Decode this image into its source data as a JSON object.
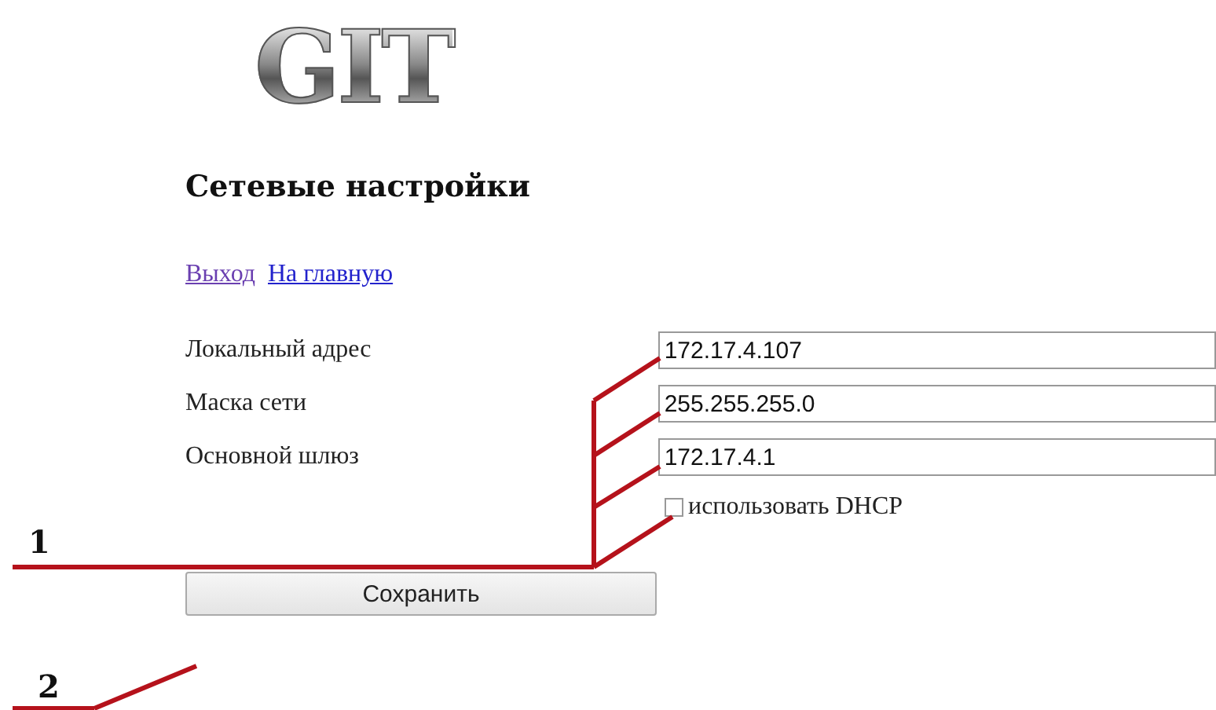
{
  "logo": {
    "text": "GIT"
  },
  "title": "Сетевые настройки",
  "links": [
    {
      "label": "Выход",
      "visited": true
    },
    {
      "label": "На главную",
      "visited": false
    }
  ],
  "fields": [
    {
      "label": "Локальный адрес",
      "value": "172.17.4.107"
    },
    {
      "label": "Маска сети",
      "value": "255.255.255.0"
    },
    {
      "label": "Основной шлюз",
      "value": "172.17.4.1"
    }
  ],
  "dhcp": {
    "label": "использовать DHCP",
    "checked": false
  },
  "save_button": "Сохранить",
  "callouts": [
    {
      "label": "1"
    },
    {
      "label": "2"
    }
  ]
}
